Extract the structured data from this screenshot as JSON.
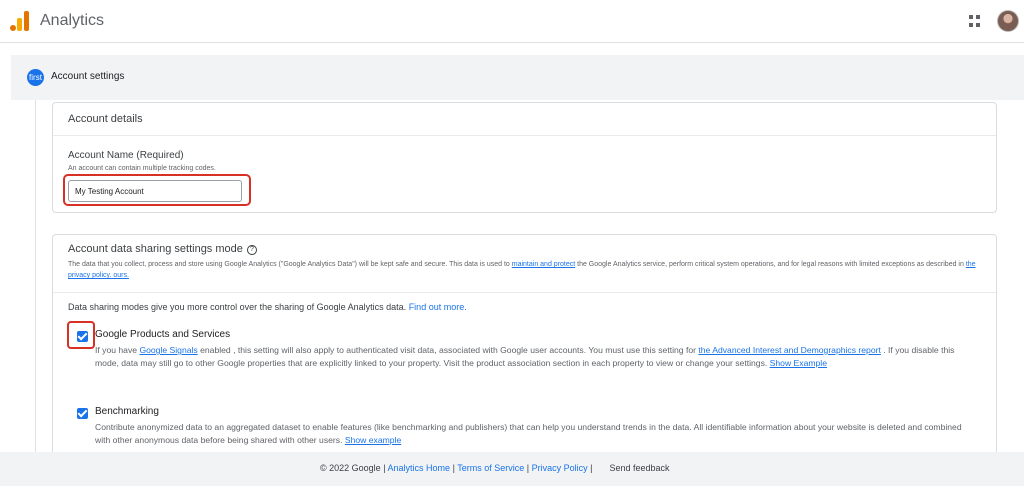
{
  "header": {
    "app_title": "Analytics",
    "apps_icon": "grid-apps-icon",
    "avatar_icon": "account-avatar"
  },
  "step": {
    "badge": "first",
    "label": "Account settings"
  },
  "account_details": {
    "title": "Account details",
    "name_label": "Account Name (Required)",
    "name_help": "An account can contain multiple tracking codes.",
    "name_value": "My Testing Account"
  },
  "sharing": {
    "title": "Account data sharing settings mode",
    "desc_part1": "The data that you collect, process and store using Google Analytics (\"Google Analytics Data\") will be kept safe and secure. This data is used to ",
    "desc_link1": "maintain and protect",
    "desc_part2": " the Google Analytics service, perform critical system operations, and for legal reasons with limited exceptions as described in ",
    "desc_link2": "the privacy policy. ours.",
    "modes_intro": "Data sharing modes give you more control over the sharing of Google Analytics data. ",
    "modes_link": "Find out more.",
    "options": [
      {
        "title": "Google Products and Services",
        "desc_part1": "If you have ",
        "desc_link1": "Google Signals",
        "desc_part2": " enabled , this setting will also apply to authenticated visit data, associated with Google user accounts. You must use this setting for ",
        "desc_link2": "the Advanced Interest and Demographics report",
        "desc_part3": " . If you disable this mode, data may still go to other Google properties that are explicitly linked to your property. Visit the product association section in each property to view or change your settings. ",
        "desc_link3": "Show Example",
        "checked": true
      },
      {
        "title": "Benchmarking",
        "desc_part1": "Contribute anonymized data to an aggregated dataset to enable features (like benchmarking and publishers) that can help you understand trends in the data. All identifiable information about your website is deleted and combined with other anonymous data before being shared with other users. ",
        "desc_link1": "Show example",
        "checked": true
      }
    ]
  },
  "footer": {
    "copyright": "© 2022 Google",
    "sep": " | ",
    "links": [
      "Analytics Home",
      "Terms of Service",
      "Privacy Policy"
    ],
    "feedback": "Send feedback"
  },
  "colors": {
    "accent": "#1a73e8",
    "highlight": "#d93025"
  }
}
